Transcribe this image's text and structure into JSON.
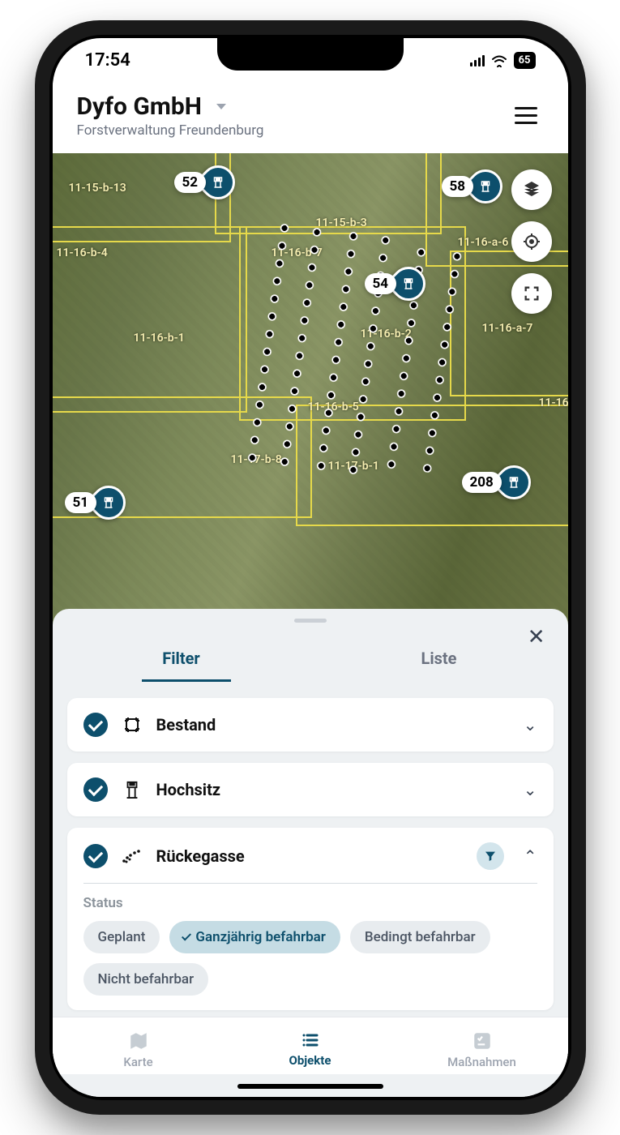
{
  "status_bar": {
    "time": "17:54",
    "battery": "65"
  },
  "header": {
    "title": "Dyfo GmbH",
    "subtitle": "Forstverwaltung Freundenburg"
  },
  "map": {
    "markers": [
      {
        "id": "m1",
        "label": "52"
      },
      {
        "id": "m2",
        "label": "58"
      },
      {
        "id": "m3",
        "label": "54"
      },
      {
        "id": "m4",
        "label": "208"
      },
      {
        "id": "m5",
        "label": "51"
      }
    ],
    "parcels": [
      "11-15-b-13",
      "11-15-b-3",
      "11-16-a-6",
      "11-16-b-4",
      "11-16-b-7",
      "11-16-b-1",
      "11-16-b-2",
      "11-16-a-7",
      "11-16-b-5",
      "11-17-b-8",
      "11-17-b-1",
      "11-16"
    ]
  },
  "sheet": {
    "tabs": {
      "filter": "Filter",
      "liste": "Liste"
    },
    "categories": [
      {
        "key": "bestand",
        "label": "Bestand",
        "expanded": false
      },
      {
        "key": "hochsitz",
        "label": "Hochsitz",
        "expanded": false
      },
      {
        "key": "rueckegasse",
        "label": "Rückegasse",
        "expanded": true
      }
    ],
    "status_label": "Status",
    "status_chips": [
      {
        "label": "Geplant",
        "selected": false
      },
      {
        "label": "Ganzjährig befahrbar",
        "selected": true
      },
      {
        "label": "Bedingt befahrbar",
        "selected": false
      },
      {
        "label": "Nicht befahrbar",
        "selected": false
      }
    ]
  },
  "bottom_nav": {
    "items": [
      {
        "key": "karte",
        "label": "Karte",
        "active": false
      },
      {
        "key": "objekte",
        "label": "Objekte",
        "active": true
      },
      {
        "key": "massnahmen",
        "label": "Maßnahmen",
        "active": false
      }
    ]
  }
}
